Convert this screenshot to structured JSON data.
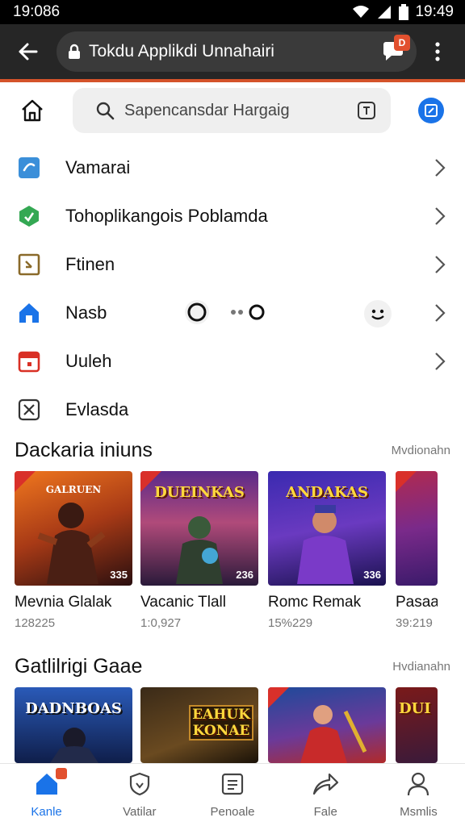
{
  "status_bar": {
    "time_left": "19:086",
    "time_right": "19:49"
  },
  "app_bar": {
    "url": "Tokdu Applikdi Unnahairi",
    "notification_badge": "D"
  },
  "search": {
    "placeholder": "Sapencansdar Hargaig"
  },
  "menu": [
    {
      "label": "Vamarai",
      "icon": "link-icon",
      "color": "#3b8fd9"
    },
    {
      "label": "Tohoplikangois Poblamda",
      "icon": "hexagon-icon",
      "color": "#34a853"
    },
    {
      "label": "Ftinen",
      "icon": "document-icon",
      "color": "#8a6a2a"
    },
    {
      "label": "Nasb",
      "icon": "house-icon",
      "color": "#1a73e8"
    },
    {
      "label": "Uuleh",
      "icon": "calendar-icon",
      "color": "#d93025"
    },
    {
      "label": "Evlasda",
      "icon": "x-box-icon",
      "color": "#333333"
    }
  ],
  "section1": {
    "title": "Dackaria iniuns",
    "more": "Mvdionahn",
    "cards": [
      {
        "name": "Mevnia Glalak",
        "meta": "128225",
        "art_title": "GALRUEN",
        "badge": "335",
        "colors": [
          "#f0771e",
          "#6a1d1d"
        ]
      },
      {
        "name": "Vacanic Tlall",
        "meta": "1:0,927",
        "art_title": "DUEINKAS",
        "badge": "236",
        "colors": [
          "#5a2a8a",
          "#e87a2a"
        ]
      },
      {
        "name": "Romc Remak",
        "meta": "15%229",
        "art_title": "ANDAKAS",
        "badge": "336",
        "colors": [
          "#3a2ab0",
          "#1b1250"
        ]
      },
      {
        "name": "Pasaa",
        "meta": "39:219",
        "art_title": "",
        "badge": "",
        "colors": [
          "#b02a50",
          "#3a1a6a"
        ]
      }
    ]
  },
  "section2": {
    "title": "Gatlilrigi Gaae",
    "more": "Hvdianahn",
    "cards": [
      {
        "art_title": "DADNBOAS",
        "colors": [
          "#2a5ab8",
          "#0f1e4a"
        ]
      },
      {
        "art_title": "EAHUK KONAE",
        "colors": [
          "#3a2a18",
          "#c48a2a"
        ]
      },
      {
        "art_title": "",
        "colors": [
          "#1e4a9a",
          "#b02a2a"
        ]
      },
      {
        "art_title": "DUI",
        "colors": [
          "#7a1a1a",
          "#e0a020"
        ]
      }
    ]
  },
  "bottom_nav": [
    {
      "label": "Kanle",
      "icon": "home-icon",
      "active": true
    },
    {
      "label": "Vatilar",
      "icon": "shield-icon",
      "active": false
    },
    {
      "label": "Penoale",
      "icon": "list-icon",
      "active": false
    },
    {
      "label": "Fale",
      "icon": "share-icon",
      "active": false
    },
    {
      "label": "Msmlis",
      "icon": "person-icon",
      "active": false
    }
  ]
}
